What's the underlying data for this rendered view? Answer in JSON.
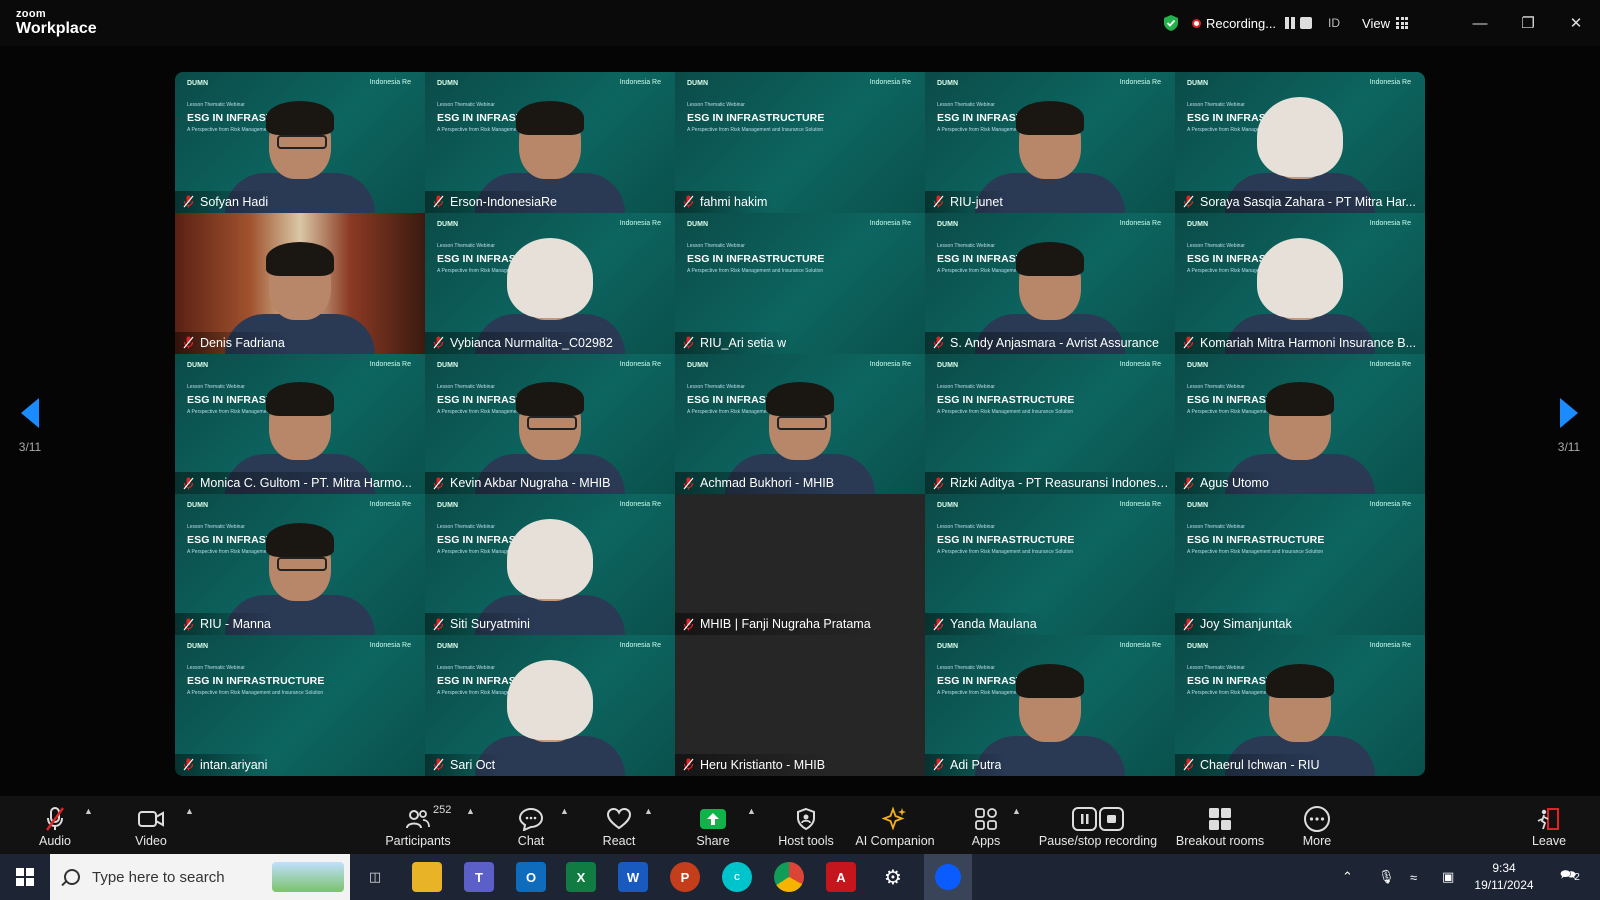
{
  "app": {
    "brand_small": "zoom",
    "brand_large": "Workplace"
  },
  "titlebar": {
    "recording_text": "Recording...",
    "id_label": "ID",
    "view_label": "View"
  },
  "slide": {
    "top_left": "DUMN",
    "top_right": "Indonesia Re",
    "subtitle": "Lesson Thematic Webinar",
    "headline": "ESG IN INFRASTRUCTURE",
    "tagline": "A Perspective from Risk Management and Insurance Solution"
  },
  "participants": [
    {
      "name": "Sofyan Hadi",
      "tile": "person",
      "style": "glasses"
    },
    {
      "name": "Erson-IndonesiaRe",
      "tile": "person",
      "style": "plain"
    },
    {
      "name": "fahmi hakim",
      "tile": "slide",
      "style": "none"
    },
    {
      "name": "RIU-junet",
      "tile": "person",
      "style": "plain"
    },
    {
      "name": "Soraya Sasqia Zahara - PT Mitra Har...",
      "tile": "person",
      "style": "hijab"
    },
    {
      "name": "Denis Fadriana",
      "tile": "room",
      "style": "none"
    },
    {
      "name": "Vybianca Nurmalita-_C02982",
      "tile": "person",
      "style": "hijab"
    },
    {
      "name": "RIU_Ari setia w",
      "tile": "slide",
      "style": "none"
    },
    {
      "name": "S. Andy Anjasmara - Avrist Assurance",
      "tile": "person",
      "style": "plain"
    },
    {
      "name": "Komariah Mitra Harmoni Insurance B...",
      "tile": "person",
      "style": "hijab"
    },
    {
      "name": "Monica C. Gultom - PT. Mitra Harmo...",
      "tile": "person",
      "style": "plain"
    },
    {
      "name": "Kevin Akbar Nugraha - MHIB",
      "tile": "person",
      "style": "glasses"
    },
    {
      "name": "Achmad Bukhori - MHIB",
      "tile": "person",
      "style": "glasses"
    },
    {
      "name": "Rizki Aditya - PT Reasuransi Indonesi...",
      "tile": "slide",
      "style": "none"
    },
    {
      "name": "Agus Utomo",
      "tile": "person",
      "style": "plain"
    },
    {
      "name": "RIU - Manna",
      "tile": "person",
      "style": "glasses"
    },
    {
      "name": "Siti Suryatmini",
      "tile": "person",
      "style": "hijab"
    },
    {
      "name": "MHIB | Fanji Nugraha Pratama",
      "tile": "blank",
      "style": "none"
    },
    {
      "name": "Yanda Maulana",
      "tile": "slide",
      "style": "none"
    },
    {
      "name": "Joy Simanjuntak",
      "tile": "slide",
      "style": "none"
    },
    {
      "name": "intan.ariyani",
      "tile": "slide",
      "style": "none"
    },
    {
      "name": "Sari Oct",
      "tile": "person",
      "style": "hijab"
    },
    {
      "name": "Heru Kristianto - MHIB",
      "tile": "blank",
      "style": "none"
    },
    {
      "name": "Adi Putra",
      "tile": "person",
      "style": "plain"
    },
    {
      "name": "Chaerul Ichwan - RIU",
      "tile": "person",
      "style": "plain"
    }
  ],
  "pager": {
    "left": "3/11",
    "right": "3/11"
  },
  "toolbar": {
    "audio": "Audio",
    "video": "Video",
    "participants": "Participants",
    "participants_count": "252",
    "chat": "Chat",
    "react": "React",
    "share": "Share",
    "host_tools": "Host tools",
    "ai_companion": "AI Companion",
    "apps": "Apps",
    "pause_stop": "Pause/stop recording",
    "breakout": "Breakout rooms",
    "more": "More",
    "leave": "Leave"
  },
  "taskbar": {
    "search_placeholder": "Type here to search",
    "time": "9:34",
    "date": "19/11/2024",
    "notif_count": "2"
  },
  "colors": {
    "accent": "#1a8cff",
    "tile_bg": "#0d6560",
    "share": "#12b24a",
    "leave": "#e02424"
  }
}
